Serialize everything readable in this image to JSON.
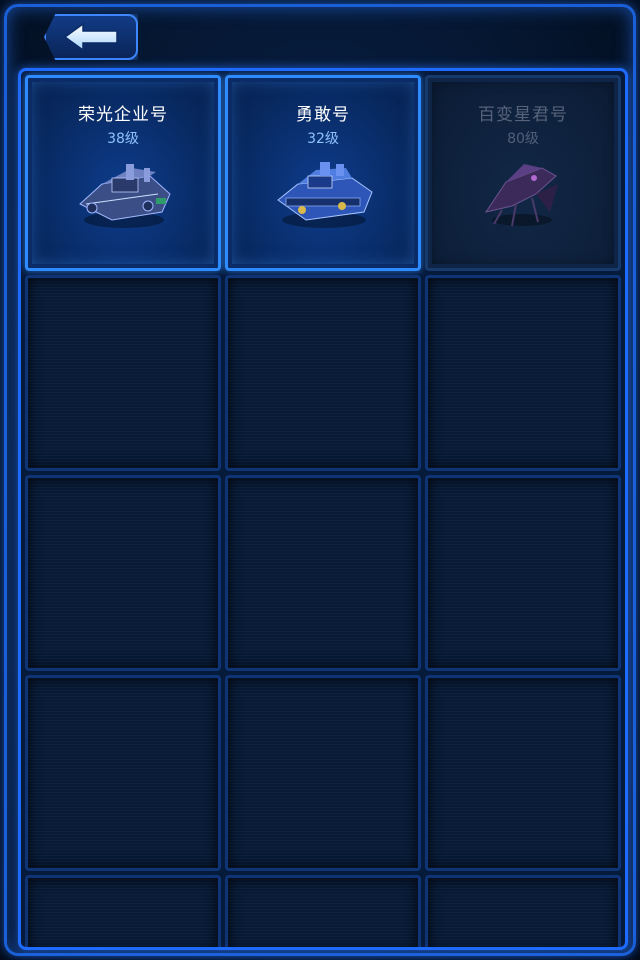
{
  "header": {
    "back_icon": "back-arrow-icon"
  },
  "ships": [
    {
      "name": "荣光企业号",
      "level": "38级",
      "state": "unlocked",
      "icon": "battleship-icon"
    },
    {
      "name": "勇敢号",
      "level": "32级",
      "state": "unlocked",
      "icon": "tank-ship-icon"
    },
    {
      "name": "百变星君号",
      "level": "80级",
      "state": "locked",
      "icon": "alien-ship-icon"
    }
  ],
  "colors": {
    "accent": "#2e8bff",
    "panel": "#061a3c",
    "level_text": "#8fc0ff",
    "locked_text": "#56637a"
  }
}
